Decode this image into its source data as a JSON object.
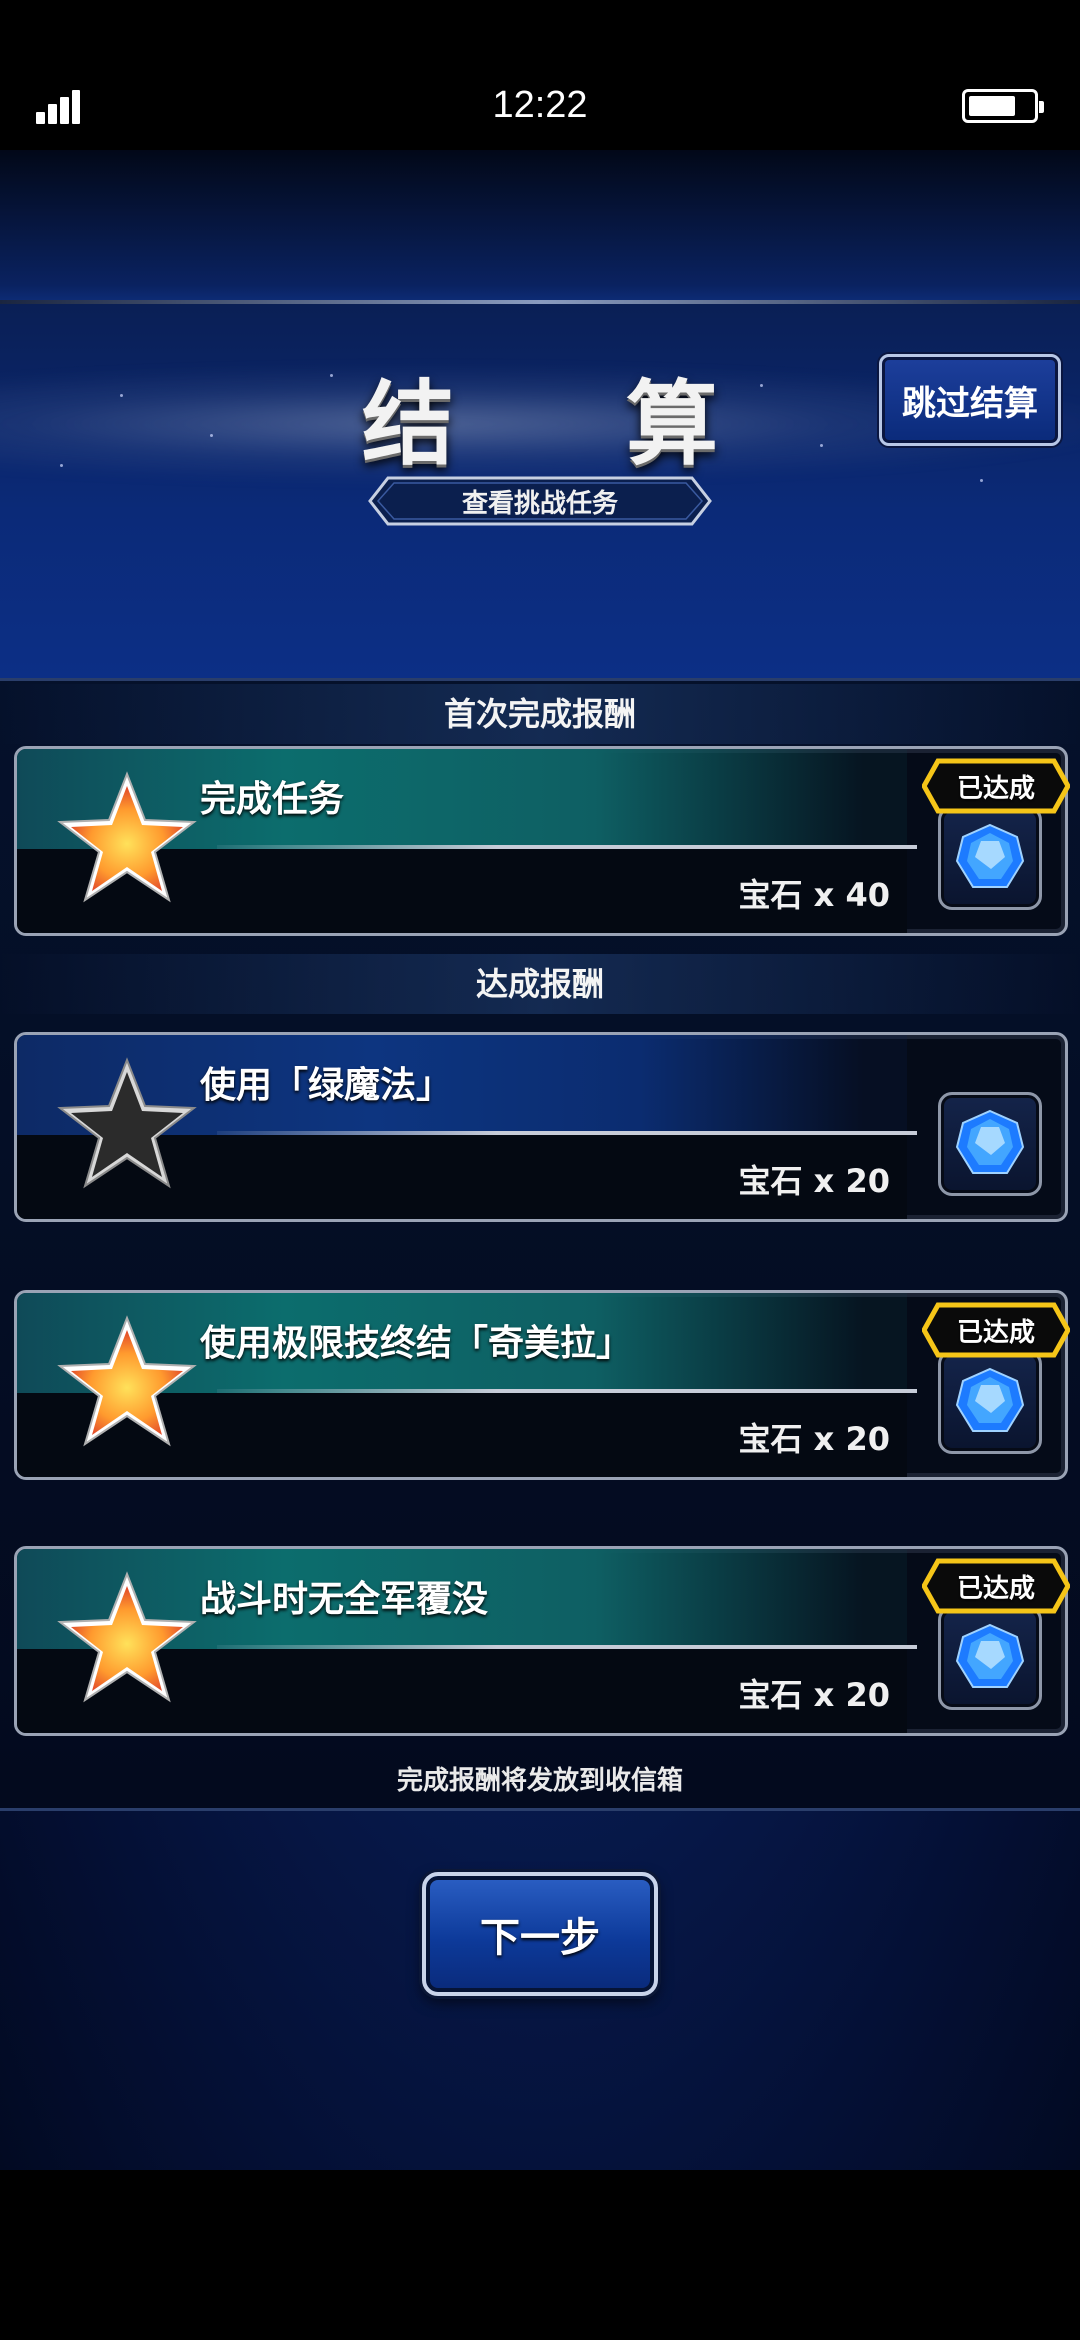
{
  "status_bar": {
    "time": "12:22"
  },
  "header": {
    "title": "结 算",
    "skip_label": "跳过结算",
    "view_tasks_label": "查看挑战任务"
  },
  "sections": {
    "first_clear_label": "首次完成报酬",
    "achievement_label": "达成报酬"
  },
  "missions": [
    {
      "title": "完成任务",
      "reward": "宝石 x 40",
      "achieved": true,
      "badge": "已达成"
    },
    {
      "title": "使用「绿魔法」",
      "reward": "宝石 x 20",
      "achieved": false,
      "badge": ""
    },
    {
      "title": "使用极限技终结「奇美拉」",
      "reward": "宝石 x 20",
      "achieved": true,
      "badge": "已达成"
    },
    {
      "title": "战斗时无全军覆没",
      "reward": "宝石 x 20",
      "achieved": true,
      "badge": "已达成"
    }
  ],
  "footer_note": "完成报酬将发放到收信箱",
  "next_label": "下一步",
  "icons": {
    "star_achieved": "gold-star-icon",
    "star_not_achieved": "dark-star-icon",
    "reward": "blue-gem-icon"
  },
  "colors": {
    "background": "#081d55",
    "achieved_band": "#0c6d6d",
    "badge": "#f2c21a"
  }
}
